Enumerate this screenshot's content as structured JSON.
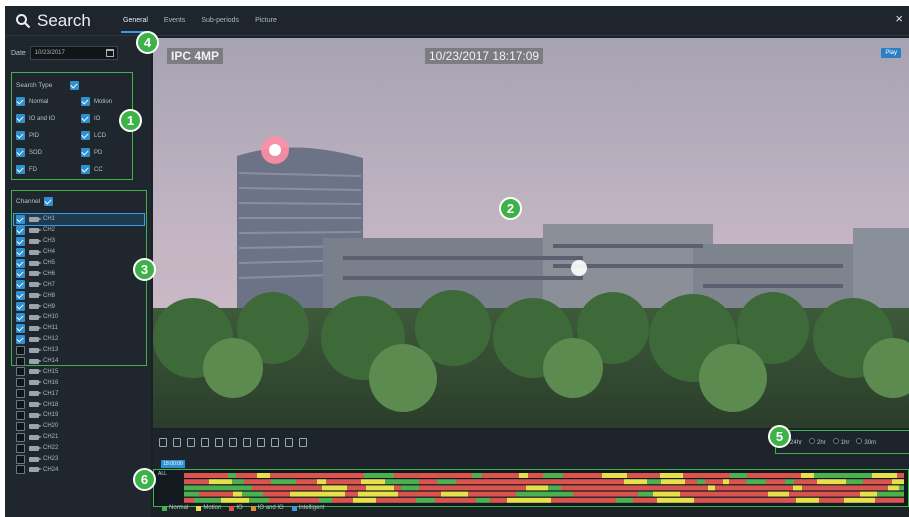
{
  "header": {
    "title": "Search",
    "tabs": [
      {
        "label": "General",
        "active": true
      },
      {
        "label": "Events",
        "active": false
      },
      {
        "label": "Sub-periods",
        "active": false
      },
      {
        "label": "Picture",
        "active": false
      }
    ],
    "close": "×"
  },
  "date": {
    "label": "Date",
    "value": "10/23/2017"
  },
  "search_type": {
    "label": "Search Type",
    "items": [
      {
        "label": "Normal",
        "checked": true
      },
      {
        "label": "Motion",
        "checked": true
      },
      {
        "label": "IO and IO",
        "checked": true
      },
      {
        "label": "IO",
        "checked": true
      },
      {
        "label": "PID",
        "checked": true
      },
      {
        "label": "LCD",
        "checked": true
      },
      {
        "label": "SOD",
        "checked": true
      },
      {
        "label": "PD",
        "checked": true
      },
      {
        "label": "FD",
        "checked": true
      },
      {
        "label": "CC",
        "checked": true
      }
    ]
  },
  "channels": {
    "label": "Channel",
    "items": [
      {
        "label": "CH1",
        "checked": true,
        "selected": true
      },
      {
        "label": "CH2",
        "checked": true
      },
      {
        "label": "CH3",
        "checked": true
      },
      {
        "label": "CH4",
        "checked": true
      },
      {
        "label": "CH5",
        "checked": true
      },
      {
        "label": "CH6",
        "checked": true
      },
      {
        "label": "CH7",
        "checked": true
      },
      {
        "label": "CH8",
        "checked": true
      },
      {
        "label": "CH9",
        "checked": true
      },
      {
        "label": "CH10",
        "checked": true
      },
      {
        "label": "CH11",
        "checked": true
      },
      {
        "label": "CH12",
        "checked": true
      },
      {
        "label": "CH13",
        "checked": false
      },
      {
        "label": "CH14",
        "checked": false
      },
      {
        "label": "CH15",
        "checked": false
      },
      {
        "label": "CH16",
        "checked": false
      },
      {
        "label": "CH17",
        "checked": false
      },
      {
        "label": "CH18",
        "checked": false
      },
      {
        "label": "CH19",
        "checked": false
      },
      {
        "label": "CH20",
        "checked": false
      },
      {
        "label": "CH21",
        "checked": false
      },
      {
        "label": "CH22",
        "checked": false
      },
      {
        "label": "CH23",
        "checked": false
      },
      {
        "label": "CH24",
        "checked": false
      }
    ]
  },
  "video": {
    "camera_label": "IPC 4MP",
    "timestamp": "10/23/2017 18:17:09",
    "play_label": "Play"
  },
  "time_scale": {
    "options": [
      {
        "label": "24hr",
        "selected": true
      },
      {
        "label": "2hr",
        "selected": false
      },
      {
        "label": "1hr",
        "selected": false
      },
      {
        "label": "30m",
        "selected": false
      }
    ]
  },
  "timeline": {
    "row_label": "ALL",
    "current_tag": "18:00:00"
  },
  "legend": [
    {
      "label": "Normal",
      "color": "#4caf50"
    },
    {
      "label": "Motion",
      "color": "#e6e04a"
    },
    {
      "label": "IO",
      "color": "#e05050"
    },
    {
      "label": "IO and IO",
      "color": "#e08a3a"
    },
    {
      "label": "Intelligent",
      "color": "#3c9bd8"
    }
  ],
  "badges": [
    "1",
    "2",
    "3",
    "4",
    "5",
    "6"
  ]
}
